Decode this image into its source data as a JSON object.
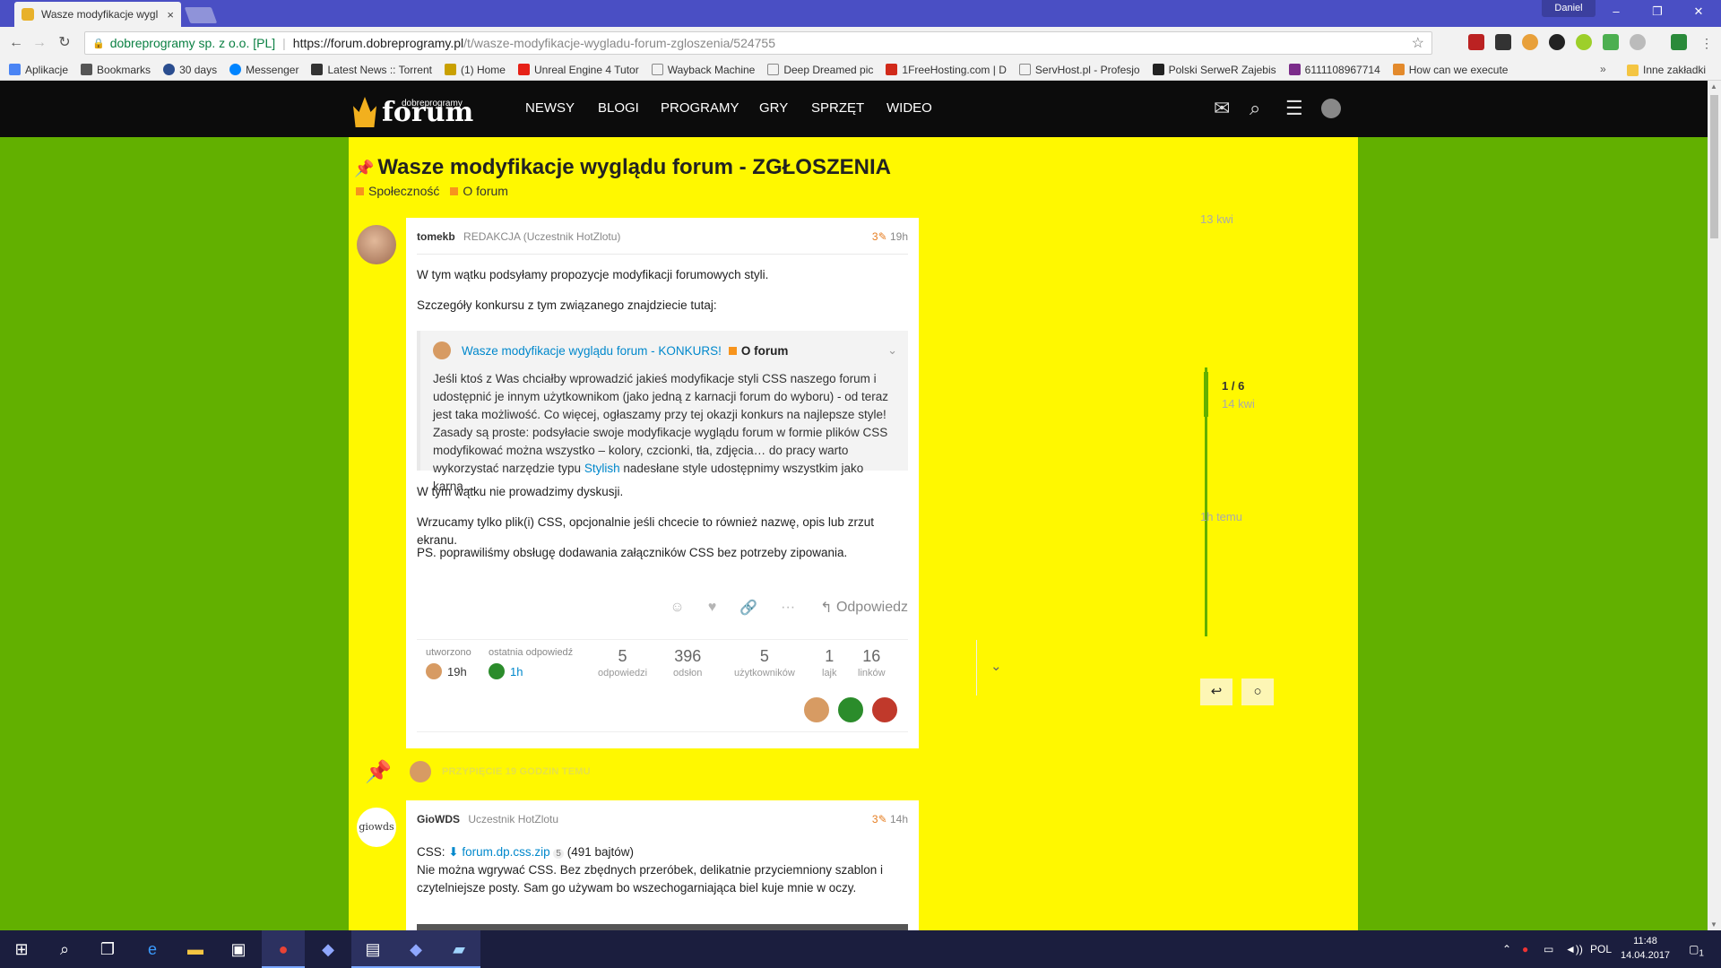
{
  "browser": {
    "tab_title": "Wasze modyfikacje wygl",
    "tab_close": "×",
    "user": "Daniel",
    "window_controls": {
      "minimize": "–",
      "restore": "❐",
      "close": "✕"
    },
    "site_name": "dobreprogramy sp. z o.o. [PL]",
    "url_host": "https://forum.dobreprogramy.pl",
    "url_path": "/t/wasze-modyfikacje-wygladu-forum-zgloszenia/524755",
    "bookmarks": [
      {
        "label": "Aplikacje",
        "color": "#4a84f4"
      },
      {
        "label": "Bookmarks",
        "color": "#555555"
      },
      {
        "label": "30 days",
        "color": "#2a4d8f"
      },
      {
        "label": "Messenger",
        "color": "#0084ff"
      },
      {
        "label": "Latest News :: Torrent",
        "color": "#333333"
      },
      {
        "label": "(1) Home",
        "color": "#c9a000"
      },
      {
        "label": "Unreal Engine 4 Tutor",
        "color": "#e62117"
      },
      {
        "label": "Wayback Machine",
        "color": "#999999"
      },
      {
        "label": "Deep Dreamed pic",
        "color": "#999999"
      },
      {
        "label": "1FreeHosting.com | D",
        "color": "#d12a1a"
      },
      {
        "label": "ServHost.pl - Profesjo",
        "color": "#999999"
      },
      {
        "label": "Polski SerweR Zajebis",
        "color": "#222222"
      },
      {
        "label": "6111108967714",
        "color": "#7b2c8a"
      },
      {
        "label": "How can we execute",
        "color": "#e38a2c"
      }
    ],
    "bookmarks_more": "»",
    "other_bookmarks": "Inne zakładki"
  },
  "forum": {
    "logo_sub": "dobreprogramy",
    "logo_text": "forum",
    "nav": [
      "NEWSY",
      "BLOGI",
      "PROGRAMY",
      "GRY",
      "SPRZĘT",
      "WIDEO"
    ]
  },
  "topic": {
    "title": "Wasze modyfikacje wyglądu forum - ZGŁOSZENIA",
    "categories": [
      {
        "name": "Społeczność",
        "color": "#f7941d"
      },
      {
        "name": "O forum",
        "color": "#f7941d"
      }
    ]
  },
  "post1": {
    "username": "tomekb",
    "title": "REDAKCJA (Uczestnik HotZlotu)",
    "edits": "3",
    "age": "19h",
    "p1": "W tym wątku podsyłamy propozycje modyfikacji forumowych styli.",
    "p2": "Szczegóły konkursu z tym związanego znajdziecie tutaj:",
    "quote_link": "Wasze modyfikacje wyglądu forum - KONKURS!",
    "quote_cat": "O forum",
    "quote_text": "Jeśli ktoś z Was chciałby wprowadzić jakieś modyfikacje styli CSS naszego forum i udostępnić je innym użytkownikom (jako jedną z karnacji forum do wyboru) - od teraz jest taka możliwość. Co więcej, ogłaszamy przy tej okazji konkurs na najlepsze style! Zasady są proste: podsyłacie swoje modyfikacje wyglądu forum w formie plików CSS modyfikować można wszystko – kolory, czcionki, tła, zdjęcia… do pracy warto wykorzystać narzędzie typu ",
    "quote_stylish": "Stylish",
    "quote_tail": " nadesłane style udostępnimy wszystkim jako karna…",
    "p3": "W tym wątku nie prowadzimy dyskusji.",
    "p4": "Wrzucamy tylko plik(i) CSS, opcjonalnie jeśli chcecie to również nazwę, opis lub zrzut ekranu.",
    "p5": "PS. poprawiliśmy obsługę dodawania załączników CSS bez potrzeby zipowania.",
    "reply": "Odpowiedz",
    "created_label": "utworzono",
    "created_value": "19h",
    "last_reply_label": "ostatnia odpowiedź",
    "last_reply_value": "1h",
    "stats": [
      {
        "n": "5",
        "l": "odpowiedzi"
      },
      {
        "n": "396",
        "l": "odsłon"
      },
      {
        "n": "5",
        "l": "użytkowników"
      },
      {
        "n": "1",
        "l": "lajk"
      },
      {
        "n": "16",
        "l": "linków"
      }
    ]
  },
  "small_action": {
    "text": "PRZYPIĘCIE 19 GODZIN TEMU"
  },
  "post2": {
    "avatar_text": "giowds",
    "username": "GioWDS",
    "title": "Uczestnik HotZlotu",
    "edits": "3",
    "age": "14h",
    "css_label": "CSS:",
    "file_name": "forum.dp.css.zip",
    "downloads": "5",
    "file_size": "(491 bajtów)",
    "body": "Nie można wgrywać CSS. Bez zbędnych przeróbek, delikatnie przyciemniony szablon i czytelniejsze posty. Sam go używam bo wszechogarniająca biel kuje mnie w oczy."
  },
  "timeline": {
    "start": "13 kwi",
    "position": "1 / 6",
    "position_date": "14 kwi",
    "end": "1h temu"
  },
  "taskbar": {
    "lang": "POL",
    "time": "11:48",
    "date": "14.04.2017",
    "notif": "1"
  },
  "colors": {
    "page_bg": "#62b000",
    "content_bg": "#fff800",
    "header_bg": "#0c0c0c",
    "chrome_frame": "#4a4fc4"
  }
}
